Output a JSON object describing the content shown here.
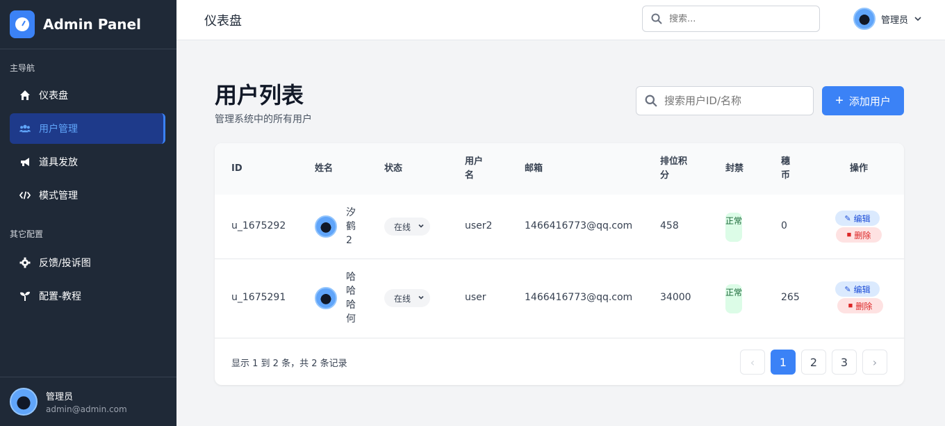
{
  "sidebar": {
    "brand": "Admin Panel",
    "section_main": "主导航",
    "section_other": "其它配置",
    "items": [
      {
        "label": "仪表盘",
        "icon": "home-icon"
      },
      {
        "label": "用户管理",
        "icon": "users-icon",
        "active": true
      },
      {
        "label": "道具发放",
        "icon": "megaphone-icon"
      },
      {
        "label": "模式管理",
        "icon": "code-icon"
      },
      {
        "label": "反馈/投诉图",
        "icon": "gear-icon"
      },
      {
        "label": "配置-教程",
        "icon": "seedling-icon"
      }
    ],
    "user": {
      "name": "管理员",
      "email": "admin@admin.com"
    }
  },
  "topbar": {
    "title": "仪表盘",
    "search_placeholder": "搜索...",
    "user_name": "管理员"
  },
  "main": {
    "title": "用户列表",
    "subtitle": "管理系统中的所有用户",
    "search_placeholder": "搜索用户ID/名称",
    "add_label": "添加用户"
  },
  "table": {
    "headers": {
      "id": "ID",
      "name": "姓名",
      "status": "状态",
      "username": "用户名",
      "email": "邮箱",
      "rank": "排位积分",
      "ban": "封禁",
      "coins": "穗币",
      "actions": "操作"
    },
    "rows": [
      {
        "id": "u_1675292",
        "name": "汐鹤2",
        "status": "在线",
        "username": "user2",
        "email": "1466416773@qq.com",
        "rank": "458",
        "ban": "正常",
        "coins": "0",
        "edit": "编辑",
        "delete": "删除"
      },
      {
        "id": "u_1675291",
        "name": "哈哈哈何",
        "status": "在线",
        "username": "user",
        "email": "1466416773@qq.com",
        "rank": "34000",
        "ban": "正常",
        "coins": "265",
        "edit": "编辑",
        "delete": "删除"
      }
    ],
    "footer": "显示 1 到 2 条，共 2 条记录",
    "pages": [
      "1",
      "2",
      "3"
    ],
    "current_page": "1",
    "prev_symbol": "‹",
    "next_symbol": "›"
  },
  "colors": {
    "sidebar_bg": "#1f2937",
    "accent": "#3b82f6",
    "active_bg": "#1e3a8a"
  }
}
